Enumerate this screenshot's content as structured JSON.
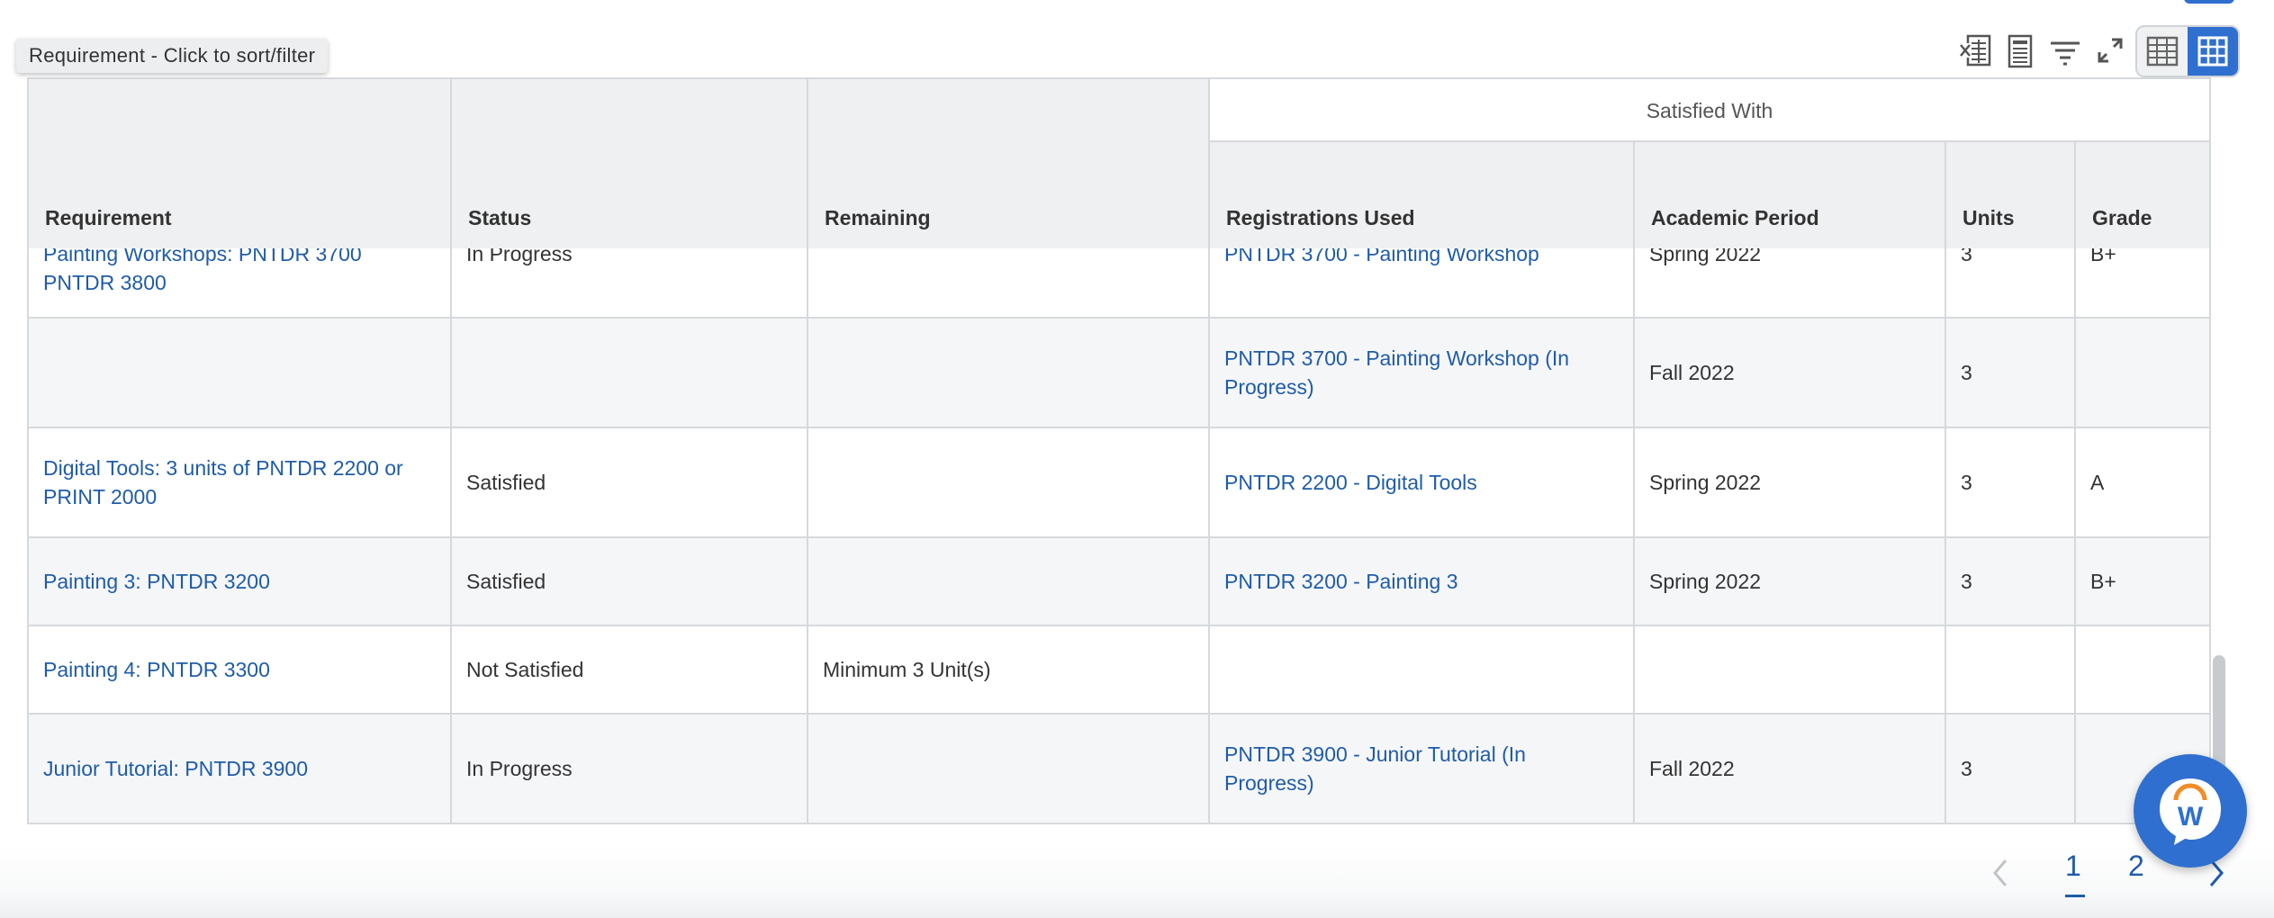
{
  "tooltip": {
    "text": "Requirement - Click to sort/filter"
  },
  "toolbar": {
    "icons": [
      "export-excel-icon",
      "export-pdf-icon",
      "filter-icon",
      "fullscreen-icon"
    ],
    "view_toggle": [
      "table-view-icon",
      "grid-view-icon"
    ]
  },
  "table": {
    "group_header": "Satisfied With",
    "columns": {
      "requirement": "Requirement",
      "status": "Status",
      "remaining": "Remaining",
      "registrations_used": "Registrations Used",
      "academic_period": "Academic Period",
      "units": "Units",
      "grade": "Grade"
    },
    "rows": [
      {
        "requirement": "Painting Workshops: PNTDR 3700 PNTDR 3800",
        "status": "In Progress",
        "remaining": "",
        "registration": "PNTDR 3700 - Painting Workshop",
        "period": "Spring 2022",
        "units": "3",
        "grade": "B+"
      },
      {
        "requirement": "",
        "status": "",
        "remaining": "",
        "registration": "PNTDR 3700 - Painting Workshop (In Progress)",
        "period": "Fall 2022",
        "units": "3",
        "grade": ""
      },
      {
        "requirement": "Digital Tools: 3 units of PNTDR 2200 or PRINT 2000",
        "status": "Satisfied",
        "remaining": "",
        "registration": "PNTDR 2200 - Digital Tools",
        "period": "Spring 2022",
        "units": "3",
        "grade": "A"
      },
      {
        "requirement": "Painting 3: PNTDR 3200",
        "status": "Satisfied",
        "remaining": "",
        "registration": "PNTDR 3200 - Painting 3",
        "period": "Spring 2022",
        "units": "3",
        "grade": "B+"
      },
      {
        "requirement": "Painting 4: PNTDR 3300",
        "status": "Not Satisfied",
        "remaining": "Minimum 3 Unit(s)",
        "registration": "",
        "period": "",
        "units": "",
        "grade": ""
      },
      {
        "requirement": "Junior Tutorial: PNTDR 3900",
        "status": "In Progress",
        "remaining": "",
        "registration": "PNTDR 3900 - Junior Tutorial (In Progress)",
        "period": "Fall 2022",
        "units": "3",
        "grade": ""
      }
    ]
  },
  "pagination": {
    "pages": [
      "1",
      "2"
    ],
    "current": "1"
  },
  "help": {
    "letter": "W"
  },
  "colors": {
    "accent": "#2f6fd0",
    "link": "#1f5ca8",
    "header_bg": "#eff0f2"
  }
}
